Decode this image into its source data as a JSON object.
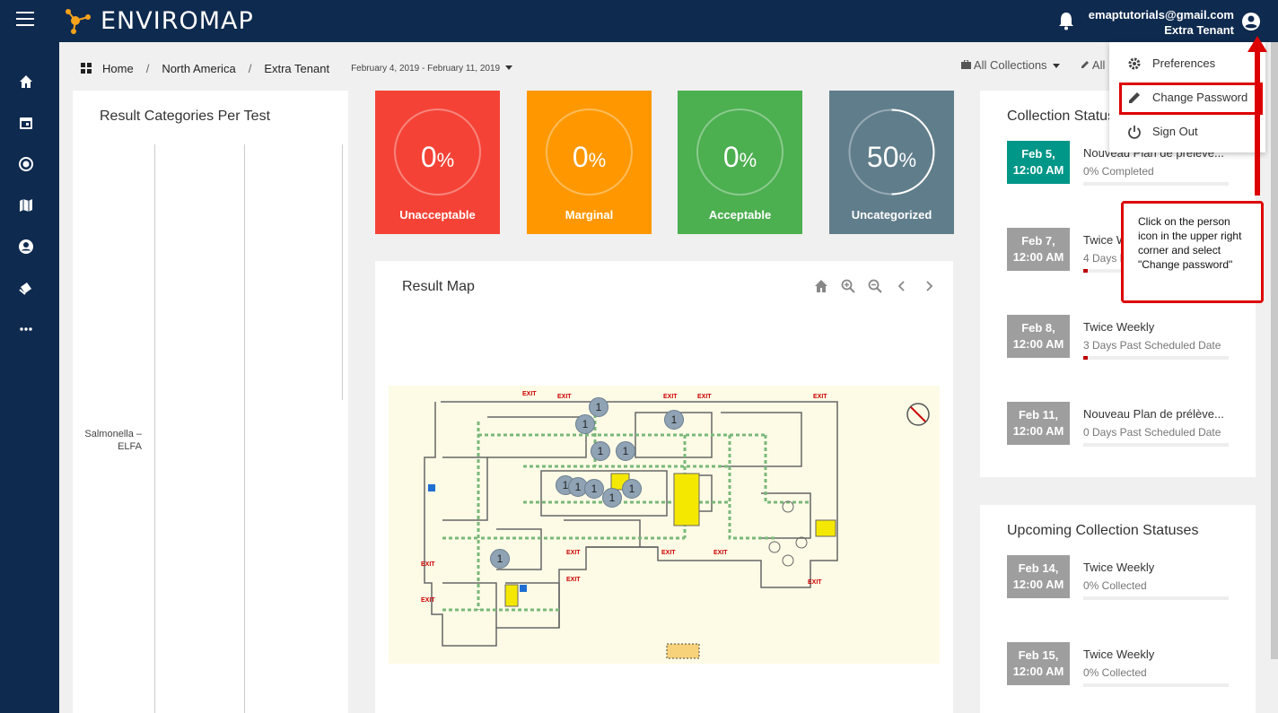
{
  "app": {
    "brand": "ENVIROMAP",
    "user_email": "emaptutorials@gmail.com",
    "user_tenant": "Extra Tenant"
  },
  "breadcrumb": {
    "home": "Home",
    "region": "North America",
    "tenant": "Extra Tenant",
    "date_range": "February 4, 2019 - February 11, 2019"
  },
  "filters": {
    "collections": "All Collections",
    "other": "All"
  },
  "left_card": {
    "title": "Result Categories Per Test",
    "row_label_1": "Salmonella –",
    "row_label_2": "ELFA"
  },
  "stats": [
    {
      "value": "0",
      "unit": "%",
      "label": "Unacceptable",
      "color": "#f44336"
    },
    {
      "value": "0",
      "unit": "%",
      "label": "Marginal",
      "color": "#ff9800"
    },
    {
      "value": "0",
      "unit": "%",
      "label": "Acceptable",
      "color": "#4caf50"
    },
    {
      "value": "50",
      "unit": "%",
      "label": "Uncategorized",
      "color": "#607d8b"
    }
  ],
  "map": {
    "title": "Result Map",
    "marker_label": "1",
    "exit_label": "EXIT"
  },
  "collection_status": {
    "title": "Collection Status",
    "items": [
      {
        "date": "Feb 5,",
        "time": "12:00 AM",
        "title": "Nouveau Plan de prélève...",
        "sub": "0% Completed",
        "date_color": "#009688"
      },
      {
        "date": "Feb 7,",
        "time": "12:00 AM",
        "title": "Twice Weekly",
        "sub": "4 Days Past Scheduled Date",
        "date_color": "#9e9e9e"
      },
      {
        "date": "Feb 8,",
        "time": "12:00 AM",
        "title": "Twice Weekly",
        "sub": "3 Days Past Scheduled Date",
        "date_color": "#9e9e9e"
      },
      {
        "date": "Feb 11,",
        "time": "12:00 AM",
        "title": "Nouveau Plan de prélève...",
        "sub": "0 Days Past Scheduled Date",
        "date_color": "#9e9e9e"
      }
    ]
  },
  "upcoming": {
    "title": "Upcoming Collection Statuses",
    "items": [
      {
        "date": "Feb 14,",
        "time": "12:00 AM",
        "title": "Twice Weekly",
        "sub": "0% Collected"
      },
      {
        "date": "Feb 15,",
        "time": "12:00 AM",
        "title": "Twice Weekly",
        "sub": "0% Collected"
      }
    ]
  },
  "user_menu": {
    "preferences": "Preferences",
    "change_password": "Change Password",
    "sign_out": "Sign Out"
  },
  "callout": {
    "text": "Click on the person icon in the upper right corner and select \"Change password\""
  },
  "colors": {
    "nav": "#0e2a4f",
    "accent_red": "#dd0000"
  }
}
